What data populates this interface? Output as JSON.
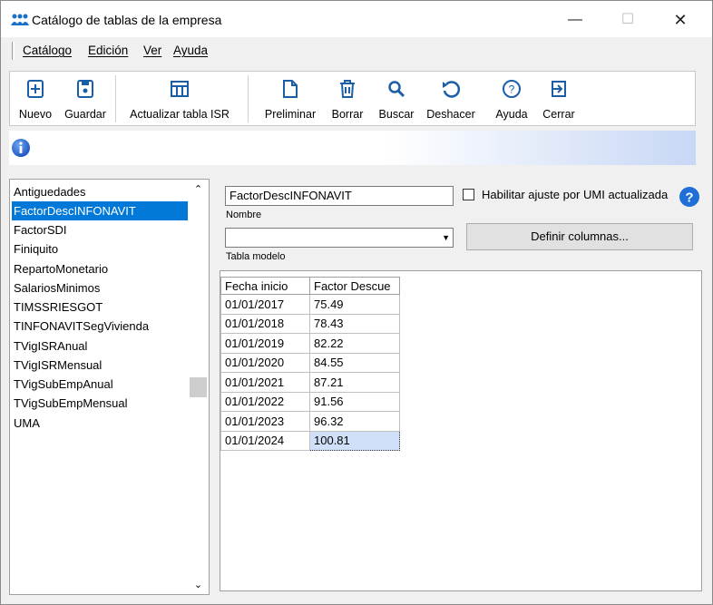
{
  "window": {
    "title": "Catálogo de tablas de la empresa",
    "minimize": "—",
    "maximize": "☐",
    "close": "✕"
  },
  "menu": {
    "items": [
      {
        "label": "Catálogo"
      },
      {
        "label": "Edición"
      },
      {
        "label": "Ver"
      },
      {
        "label": "Ayuda"
      }
    ]
  },
  "toolbar": {
    "nuevo": "Nuevo",
    "guardar": "Guardar",
    "actualizar": "Actualizar tabla ISR",
    "preliminar": "Preliminar",
    "borrar": "Borrar",
    "buscar": "Buscar",
    "deshacer": "Deshacer",
    "ayuda": "Ayuda",
    "cerrar": "Cerrar"
  },
  "tables_list": {
    "items": [
      "Antiguedades",
      "FactorDescINFONAVIT",
      "FactorSDI",
      "Finiquito",
      "RepartoMonetario",
      "SalariosMinimos",
      "TIMSSRIESGOT",
      "TINFONAVITSegVivienda",
      "TVigISRAnual",
      "TVigISRMensual",
      "TVigSubEmpAnual",
      "TVigSubEmpMensual",
      "UMA"
    ],
    "selected_index": 1
  },
  "form": {
    "nombre_value": "FactorDescINFONAVIT",
    "nombre_label": "Nombre",
    "habilitar_label": "Habilitar ajuste por UMI actualizada",
    "habilitar_checked": false,
    "tabla_modelo_value": "",
    "tabla_modelo_label": "Tabla modelo",
    "definir_columnas": "Definir columnas..."
  },
  "grid": {
    "headers": [
      "Fecha  inicio",
      "Factor  Descue"
    ],
    "rows": [
      [
        "01/01/2017",
        "75.49"
      ],
      [
        "01/01/2018",
        "78.43"
      ],
      [
        "01/01/2019",
        "82.22"
      ],
      [
        "01/01/2020",
        "84.55"
      ],
      [
        "01/01/2021",
        "87.21"
      ],
      [
        "01/01/2022",
        "91.56"
      ],
      [
        "01/01/2023",
        "96.32"
      ],
      [
        "01/01/2024",
        "100.81"
      ]
    ],
    "selected_cell": [
      7,
      1
    ]
  },
  "colors": {
    "accent": "#0078d7",
    "icon_blue": "#1b5ea8"
  }
}
